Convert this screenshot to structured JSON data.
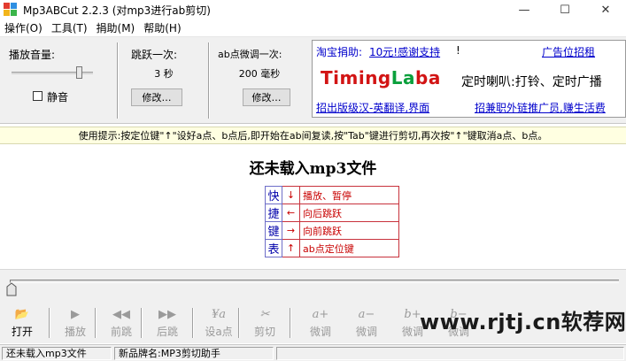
{
  "window": {
    "title": "Mp3ABCut 2.2.3  (对mp3进行ab剪切)",
    "minimize": "—",
    "maximize": "☐",
    "close": "✕"
  },
  "menu": [
    "操作(O)",
    "工具(T)",
    "捐助(M)",
    "帮助(H)"
  ],
  "volume": {
    "label": "播放音量:",
    "level": 0.84,
    "mute_label": "静音",
    "muted": false
  },
  "skip": {
    "label": "跳跃一次:",
    "value": "3  秒",
    "button": "修改…"
  },
  "fine": {
    "label": "ab点微调一次:",
    "value": "200  毫秒",
    "button": "修改…"
  },
  "ad": {
    "donate_prefix": "淘宝捐助:",
    "donate_link": "10元!感谢支持",
    "donate_suffix": "!",
    "ad_slot": "广告位招租",
    "logo_text": "TimingLaba",
    "logo_colors": [
      "#d21414",
      "#0aa03c",
      "#d21414"
    ],
    "tagline": "定时喇叭:打铃、定时广播",
    "translate": "招出版级汉-英翻译,界面",
    "recruit": "招兼职外链推广员,赚生活费"
  },
  "tip": "使用提示:按定位键\"↑\"设好a点、b点后,即开始在ab间复读,按\"Tab\"键进行剪切,再次按\"↑\"键取消a点、b点。",
  "main": {
    "status_title": "还未载入mp3文件",
    "shortcut_chars": [
      "快",
      "捷",
      "键",
      "表"
    ],
    "shortcuts": [
      {
        "arrow": "↓",
        "desc": "播放、暂停"
      },
      {
        "arrow": "←",
        "desc": "向后跳跃"
      },
      {
        "arrow": "→",
        "desc": "向前跳跃"
      },
      {
        "arrow": "↑",
        "desc": "ab点定位键"
      }
    ]
  },
  "seek": {
    "position": 0
  },
  "toolbar": [
    {
      "label": "打开",
      "icon": "📂",
      "enabled": true
    },
    {
      "label": "播放",
      "icon": "▶",
      "enabled": false
    },
    {
      "label": "前跳",
      "icon": "◀◀",
      "enabled": false
    },
    {
      "label": "后跳",
      "icon": "▶▶",
      "enabled": false
    },
    {
      "label": "设a点",
      "icon": "¥a",
      "enabled": false
    },
    {
      "label": "剪切",
      "icon": "✂",
      "enabled": false
    },
    {
      "label": "微调",
      "icon": "a+",
      "enabled": false
    },
    {
      "label": "微调",
      "icon": "a−",
      "enabled": false
    },
    {
      "label": "微调",
      "icon": "b+",
      "enabled": false
    },
    {
      "label": "微调",
      "icon": "b−",
      "enabled": false
    }
  ],
  "watermark": "www.rjtj.cn软荐网",
  "status": {
    "left": "还未载入mp3文件",
    "right": "新品牌名:MP3剪切助手"
  }
}
